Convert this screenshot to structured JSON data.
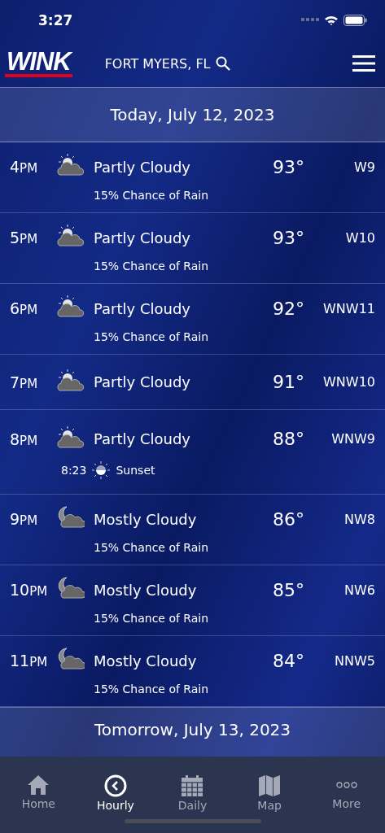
{
  "status_bar": {
    "time": "3:27"
  },
  "header": {
    "logo": "WINK",
    "location": "FORT MYERS, FL"
  },
  "day_header": "Today, July 12, 2023",
  "hours": [
    {
      "hour": "4",
      "period": "PM",
      "kind": "day",
      "condition": "Partly Cloudy",
      "temp": "93°",
      "wind": "W9",
      "detail": "15% Chance of Rain"
    },
    {
      "hour": "5",
      "period": "PM",
      "kind": "day",
      "condition": "Partly Cloudy",
      "temp": "93°",
      "wind": "W10",
      "detail": "15% Chance of Rain"
    },
    {
      "hour": "6",
      "period": "PM",
      "kind": "day",
      "condition": "Partly Cloudy",
      "temp": "92°",
      "wind": "WNW11",
      "detail": "15% Chance of Rain"
    },
    {
      "hour": "7",
      "period": "PM",
      "kind": "day",
      "condition": "Partly Cloudy",
      "temp": "91°",
      "wind": "WNW10"
    },
    {
      "hour": "8",
      "period": "PM",
      "kind": "day",
      "condition": "Partly Cloudy",
      "temp": "88°",
      "wind": "WNW9",
      "event": {
        "time": "8:23",
        "label": "Sunset"
      }
    },
    {
      "hour": "9",
      "period": "PM",
      "kind": "night",
      "condition": "Mostly Cloudy",
      "temp": "86°",
      "wind": "NW8",
      "detail": "15% Chance of Rain"
    },
    {
      "hour": "10",
      "period": "PM",
      "kind": "night",
      "condition": "Mostly Cloudy",
      "temp": "85°",
      "wind": "NW6",
      "detail": "15% Chance of Rain"
    },
    {
      "hour": "11",
      "period": "PM",
      "kind": "night",
      "condition": "Mostly Cloudy",
      "temp": "84°",
      "wind": "NNW5",
      "detail": "15% Chance of Rain"
    }
  ],
  "next_day_header": "Tomorrow, July 13, 2023",
  "tab_bar": [
    {
      "kind": "home",
      "label": "Home",
      "selected": false
    },
    {
      "kind": "hourly",
      "label": "Hourly",
      "selected": true
    },
    {
      "kind": "daily",
      "label": "Daily",
      "selected": false
    },
    {
      "kind": "map",
      "label": "Map",
      "selected": false
    },
    {
      "kind": "more",
      "label": "More",
      "selected": false
    }
  ]
}
